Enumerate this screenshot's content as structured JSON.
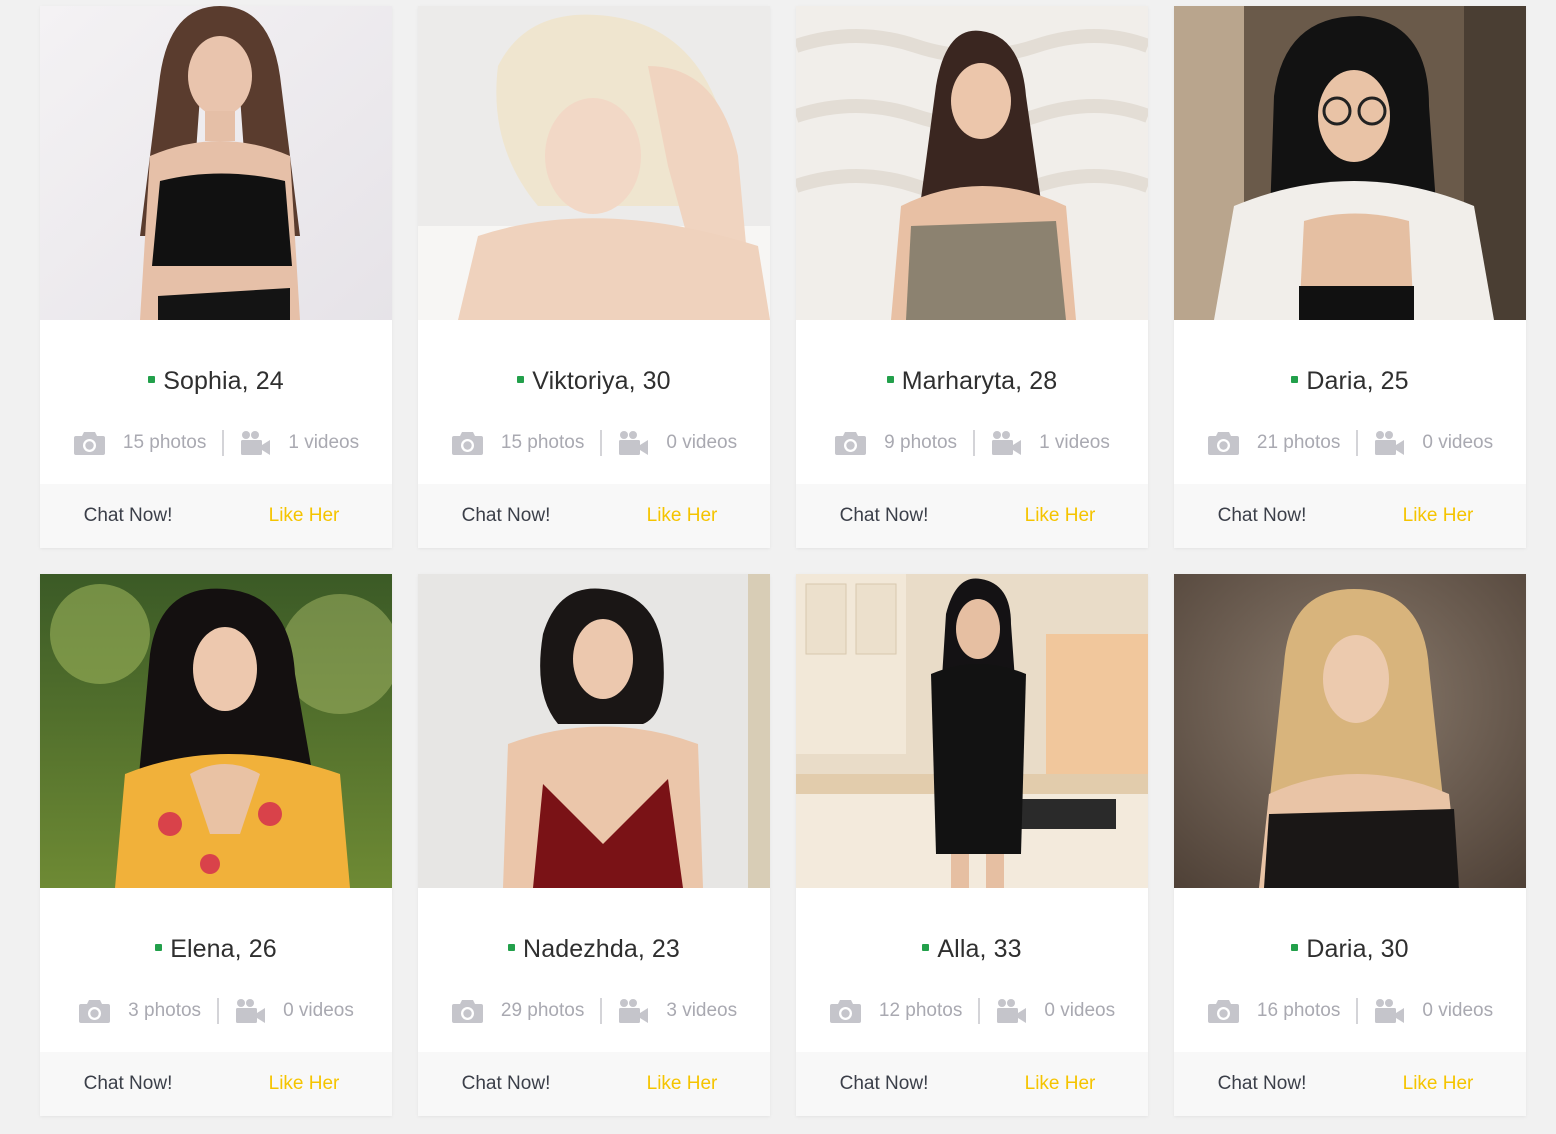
{
  "colors": {
    "online": "#22a04b",
    "like_accent": "#f5c400",
    "text_dark": "#2f2f2f",
    "text_muted": "#a9a9b1"
  },
  "profiles": [
    {
      "name_age": "Sophia, 24",
      "photos": "15 photos",
      "videos": "1 videos",
      "chat_label": "Chat Now!",
      "like_label": "Like Her",
      "online": true
    },
    {
      "name_age": "Viktoriya, 30",
      "photos": "15 photos",
      "videos": "0 videos",
      "chat_label": "Chat Now!",
      "like_label": "Like Her",
      "online": true
    },
    {
      "name_age": "Marharyta, 28",
      "photos": "9 photos",
      "videos": "1 videos",
      "chat_label": "Chat Now!",
      "like_label": "Like Her",
      "online": true
    },
    {
      "name_age": "Daria, 25",
      "photos": "21 photos",
      "videos": "0 videos",
      "chat_label": "Chat Now!",
      "like_label": "Like Her",
      "online": true
    },
    {
      "name_age": "Elena, 26",
      "photos": "3 photos",
      "videos": "0 videos",
      "chat_label": "Chat Now!",
      "like_label": "Like Her",
      "online": true
    },
    {
      "name_age": "Nadezhda, 23",
      "photos": "29 photos",
      "videos": "3 videos",
      "chat_label": "Chat Now!",
      "like_label": "Like Her",
      "online": true
    },
    {
      "name_age": "Alla, 33",
      "photos": "12 photos",
      "videos": "0 videos",
      "chat_label": "Chat Now!",
      "like_label": "Like Her",
      "online": true
    },
    {
      "name_age": "Daria, 30",
      "photos": "16 photos",
      "videos": "0 videos",
      "chat_label": "Chat Now!",
      "like_label": "Like Her",
      "online": true
    }
  ],
  "icons": {
    "photos": "camera-icon",
    "videos": "video-camera-icon",
    "online": "online-status-dot"
  }
}
